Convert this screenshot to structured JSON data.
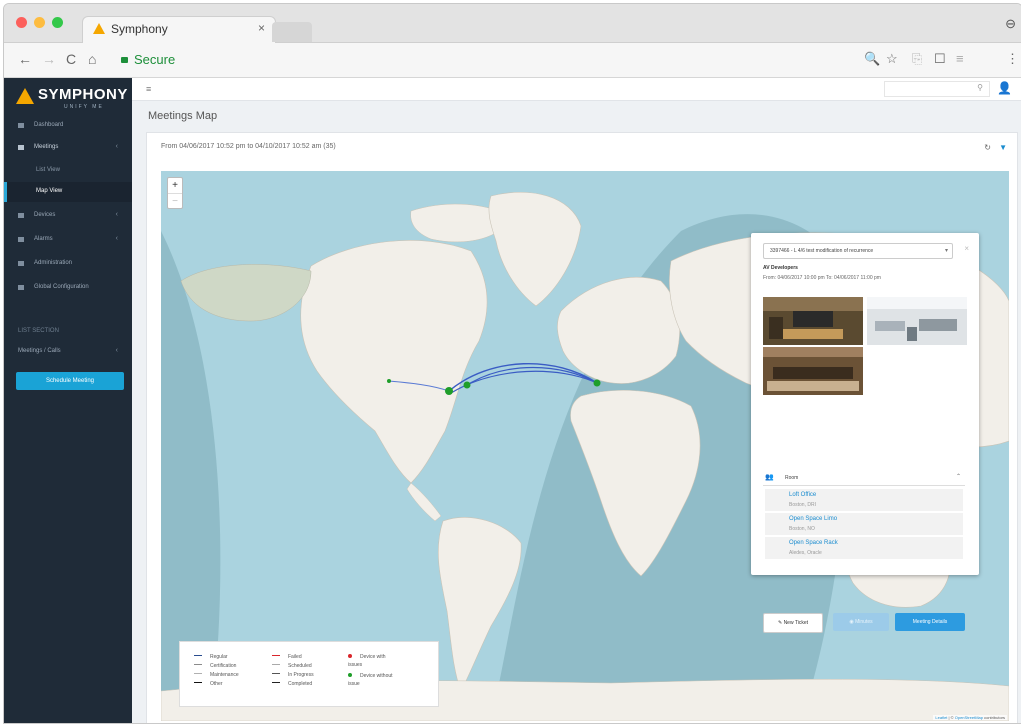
{
  "browser": {
    "tab_title": "Symphony",
    "tab_close": "×",
    "url_secure_label": "Secure",
    "nav": {
      "back": "←",
      "forward": "→",
      "reload": "C",
      "home": "⌂"
    },
    "right_icons": [
      "🔍",
      "☆",
      "⎘",
      "☐",
      "≡",
      "⋮"
    ],
    "profile_icon": "⊖",
    "dot_colors": [
      "#fc605c",
      "#fdbc40",
      "#34c84a"
    ]
  },
  "sidebar": {
    "brand_name": "SYMPHONY",
    "brand_sub": "UNIFY ME",
    "items": [
      {
        "label": "Dashboard",
        "chevron": ""
      },
      {
        "label": "Meetings",
        "chevron": "‹"
      },
      {
        "label": "List View",
        "sub": true
      },
      {
        "label": "Map View",
        "sub": true,
        "active": true
      },
      {
        "label": "Devices",
        "chevron": "‹"
      },
      {
        "label": "Alarms",
        "chevron": "‹"
      },
      {
        "label": "Administration",
        "chevron": ""
      },
      {
        "label": "Global Configuration",
        "chevron": ""
      }
    ],
    "section_label": "LIST SECTION",
    "section_item": "Meetings / Calls",
    "section_chevron": "‹",
    "schedule_button": "Schedule Meeting"
  },
  "topbar": {
    "hamburger": "≡",
    "search_icon": "⚲",
    "user_icon": "👤"
  },
  "page": {
    "title": "Meetings Map",
    "date_range": "From 04/06/2017 10:52 pm to 04/10/2017 10:52 am (35)",
    "refresh_icon": "↻",
    "filter_icon": "▼"
  },
  "map": {
    "zoom_in": "+",
    "zoom_out": "−",
    "colors": {
      "water": "#aad3df",
      "land": "#f2efe9",
      "night": "#7aa9b4",
      "night_land": "#cfd8c6"
    },
    "attribution_leaflet": "Leaflet",
    "attribution_sep": " | © ",
    "attribution_osm": "OpenStreetMap",
    "attribution_tail": " contributors"
  },
  "popup": {
    "select_value": "3397466 - L 4/6 test modification of recurrence",
    "caret": "▾",
    "close": "×",
    "title": "AV Developers",
    "when": "From: 04/06/2017 10:00 pm  To: 04/06/2017 11:00 pm",
    "rooms_label": "Room",
    "rooms_icon": "👥",
    "rooms_caret": "⌃",
    "rooms": [
      {
        "name": "Loft Office",
        "location": "Boston, DRI"
      },
      {
        "name": "Open Space Limo",
        "location": "Boston, NO"
      },
      {
        "name": "Open Space Rack",
        "location": "Aledes, Oracle"
      }
    ],
    "btn_new_ticket": "✎ New Ticket",
    "btn_middle": "◉ Minutes",
    "btn_details": "Meeting Details"
  },
  "legend": {
    "lines": [
      {
        "label": "Regular",
        "color": "#2a4d8f"
      },
      {
        "label": "Certification",
        "color": "#8b8b8b"
      },
      {
        "label": "Maintenance",
        "color": "#b0b0b0"
      },
      {
        "label": "Other",
        "color": "#111111"
      },
      {
        "label": "Failed",
        "color": "#d9262c"
      },
      {
        "label": "Scheduled",
        "color": "#aaaaaa"
      },
      {
        "label": "In Progress",
        "color": "#555555"
      },
      {
        "label": "Completed",
        "color": "#222222"
      }
    ],
    "device_with_issues_line1": "Device with",
    "device_with_issues_line2": "issues",
    "device_without_issues_line1": "Device without",
    "device_without_issues_line2": "issue",
    "issue_color": "#d9262c",
    "ok_color": "#1f9e2a"
  }
}
